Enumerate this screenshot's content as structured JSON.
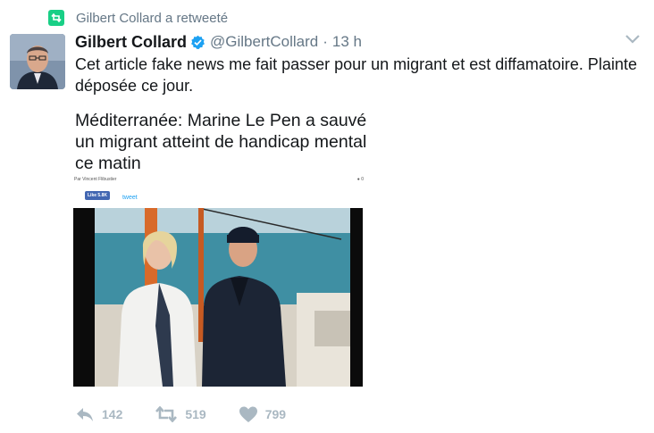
{
  "retweet": {
    "label": "Gilbert Collard a retweeté"
  },
  "tweet": {
    "display_name": "Gilbert Collard",
    "handle": "@GilbertCollard",
    "separator": "·",
    "time": "13 h",
    "text": "Cet article fake news me fait passer pour un migrant et est diffamatoire. Plainte déposée ce jour."
  },
  "article": {
    "title": "Méditerranée: Marine Le Pen a sauvé un migrant atteint de handicap mental ce matin",
    "author": "Par Vincent Flibustier",
    "comments": "0",
    "fb_like": "Like 5.8K",
    "tweet_label": "tweet"
  },
  "actions": {
    "replies": "142",
    "retweets": "519",
    "likes": "799"
  },
  "colors": {
    "retweet_badge": "#19cf86",
    "verified": "#1da1f2",
    "action_gray": "#aab8c2"
  }
}
